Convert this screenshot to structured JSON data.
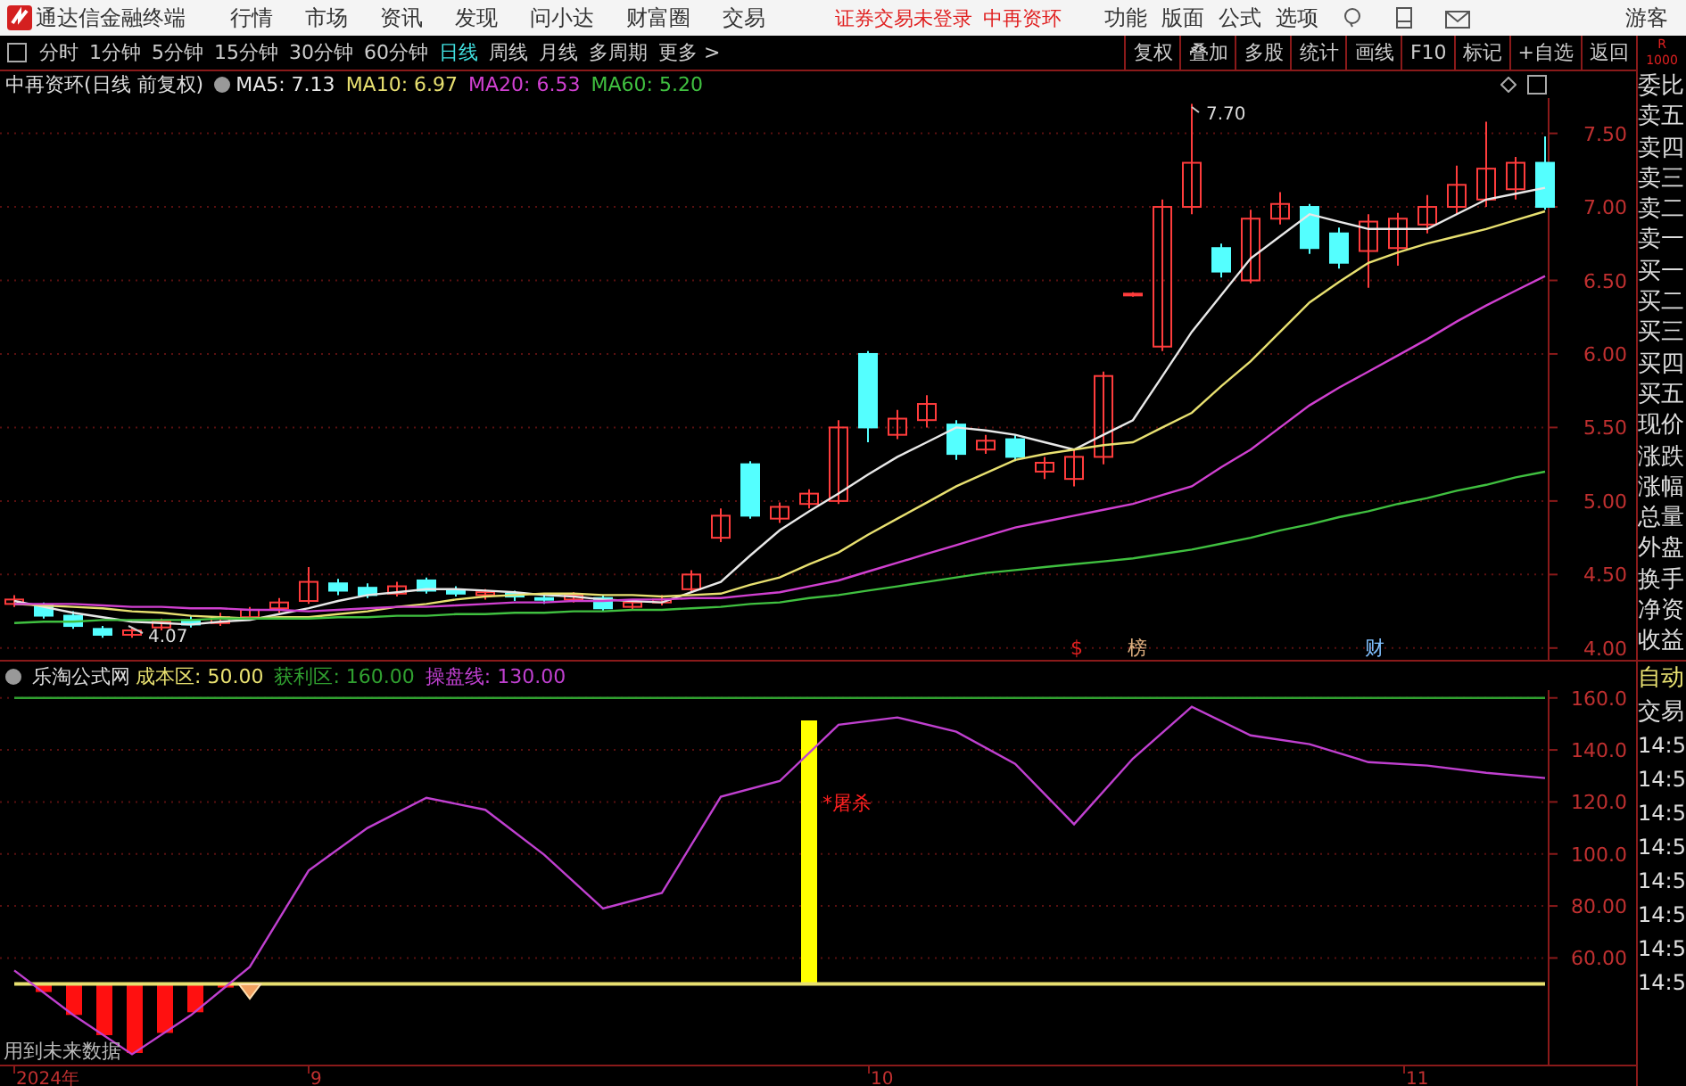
{
  "app_bar": {
    "title": "通达信金融终端",
    "menu": [
      "行情",
      "市场",
      "资讯",
      "发现",
      "问小达",
      "财富圈",
      "交易"
    ],
    "notice": "证券交易未登录",
    "stock": "中再资环",
    "tools": [
      "功能",
      "版面",
      "公式",
      "选项"
    ],
    "user": "游客"
  },
  "period_tabs": [
    {
      "label": "分时",
      "selected": false
    },
    {
      "label": "1分钟",
      "selected": false
    },
    {
      "label": "5分钟",
      "selected": false
    },
    {
      "label": "15分钟",
      "selected": false
    },
    {
      "label": "30分钟",
      "selected": false
    },
    {
      "label": "60分钟",
      "selected": false
    },
    {
      "label": "日线",
      "selected": true
    },
    {
      "label": "周线",
      "selected": false
    },
    {
      "label": "月线",
      "selected": false
    },
    {
      "label": "多周期",
      "selected": false
    },
    {
      "label": "更多 >",
      "selected": false
    }
  ],
  "actions": [
    "复权",
    "叠加",
    "多股",
    "统计",
    "画线",
    "F10",
    "标记",
    "+自选",
    "返回"
  ],
  "corner": [
    "R",
    "1000"
  ],
  "price_pane": {
    "title": "中再资环(日线 前复权)",
    "indicators": [
      {
        "label": "MA5: 7.13",
        "color": "#e8e8e8"
      },
      {
        "label": "MA10: 6.97",
        "color": "#e8e070"
      },
      {
        "label": "MA20: 6.53",
        "color": "#d040d0"
      },
      {
        "label": "MA60: 5.20",
        "color": "#40c040"
      }
    ],
    "high_label": "7.70",
    "low_label": "4.07",
    "chart_data": {
      "type": "candlestick",
      "grid": true,
      "ylim": [
        3.92,
        7.74
      ],
      "yticks": [
        {
          "value": 7.5,
          "label": "7.50"
        },
        {
          "value": 7.0,
          "label": "7.00"
        },
        {
          "value": 6.5,
          "label": "6.50"
        },
        {
          "value": 6.0,
          "label": "6.00"
        },
        {
          "value": 5.5,
          "label": "5.50"
        },
        {
          "value": 5.0,
          "label": "5.00"
        },
        {
          "value": 4.5,
          "label": "4.50"
        },
        {
          "value": 4.0,
          "label": "4.00"
        }
      ],
      "ohlc": [
        [
          4.3,
          4.36,
          4.28,
          4.33
        ],
        [
          4.29,
          4.31,
          4.2,
          4.22
        ],
        [
          4.22,
          4.25,
          4.13,
          4.15
        ],
        [
          4.13,
          4.15,
          4.07,
          4.09
        ],
        [
          4.09,
          4.14,
          4.07,
          4.12
        ],
        [
          4.14,
          4.2,
          4.12,
          4.18
        ],
        [
          4.19,
          4.22,
          4.14,
          4.16
        ],
        [
          4.17,
          4.24,
          4.15,
          4.21
        ],
        [
          4.21,
          4.28,
          4.19,
          4.26
        ],
        [
          4.27,
          4.34,
          4.24,
          4.31
        ],
        [
          4.32,
          4.55,
          4.3,
          4.45
        ],
        [
          4.44,
          4.47,
          4.36,
          4.39
        ],
        [
          4.41,
          4.44,
          4.34,
          4.36
        ],
        [
          4.37,
          4.45,
          4.35,
          4.42
        ],
        [
          4.46,
          4.48,
          4.37,
          4.39
        ],
        [
          4.39,
          4.42,
          4.35,
          4.37
        ],
        [
          4.36,
          4.4,
          4.33,
          4.38
        ],
        [
          4.37,
          4.39,
          4.32,
          4.35
        ],
        [
          4.34,
          4.37,
          4.3,
          4.33
        ],
        [
          4.33,
          4.38,
          4.31,
          4.36
        ],
        [
          4.34,
          4.36,
          4.25,
          4.27
        ],
        [
          4.28,
          4.33,
          4.26,
          4.31
        ],
        [
          4.31,
          4.36,
          4.29,
          4.33
        ],
        [
          4.4,
          4.53,
          4.38,
          4.5
        ],
        [
          4.75,
          4.95,
          4.72,
          4.9
        ],
        [
          5.25,
          5.27,
          4.88,
          4.9
        ],
        [
          4.88,
          4.99,
          4.85,
          4.96
        ],
        [
          4.98,
          5.08,
          4.95,
          5.05
        ],
        [
          5.0,
          5.55,
          4.98,
          5.5
        ],
        [
          6.0,
          6.02,
          5.4,
          5.5
        ],
        [
          5.45,
          5.62,
          5.42,
          5.56
        ],
        [
          5.55,
          5.72,
          5.5,
          5.66
        ],
        [
          5.52,
          5.55,
          5.28,
          5.32
        ],
        [
          5.35,
          5.45,
          5.32,
          5.41
        ],
        [
          5.42,
          5.45,
          5.27,
          5.3
        ],
        [
          5.2,
          5.3,
          5.15,
          5.26
        ],
        [
          5.15,
          5.35,
          5.1,
          5.3
        ],
        [
          5.3,
          5.88,
          5.25,
          5.85
        ],
        [
          6.4,
          6.42,
          6.39,
          6.41
        ],
        [
          6.05,
          7.05,
          6.02,
          7.0
        ],
        [
          7.0,
          7.7,
          6.95,
          7.3
        ],
        [
          6.72,
          6.75,
          6.52,
          6.56
        ],
        [
          6.5,
          6.98,
          6.48,
          6.92
        ],
        [
          6.92,
          7.1,
          6.88,
          7.02
        ],
        [
          7.0,
          7.02,
          6.68,
          6.72
        ],
        [
          6.82,
          6.86,
          6.58,
          6.62
        ],
        [
          6.7,
          6.95,
          6.45,
          6.9
        ],
        [
          6.72,
          6.96,
          6.6,
          6.92
        ],
        [
          6.88,
          7.08,
          6.82,
          7.0
        ],
        [
          7.0,
          7.28,
          6.95,
          7.15
        ],
        [
          7.05,
          7.58,
          7.0,
          7.26
        ],
        [
          7.12,
          7.34,
          7.05,
          7.3
        ],
        [
          7.3,
          7.48,
          6.98,
          7.0
        ]
      ],
      "series": [
        {
          "type": "line",
          "color": "#e8e8e8",
          "values": [
            4.32,
            4.28,
            4.24,
            4.21,
            4.18,
            4.17,
            4.16,
            4.18,
            4.19,
            4.23,
            4.27,
            4.32,
            4.36,
            4.38,
            4.4,
            4.4,
            4.39,
            4.38,
            4.36,
            4.35,
            4.33,
            4.32,
            4.31,
            4.38,
            4.45,
            4.63,
            4.8,
            4.93,
            5.05,
            5.18,
            5.3,
            5.4,
            5.5,
            5.48,
            5.45,
            5.4,
            5.35,
            5.45,
            5.55,
            5.85,
            6.15,
            6.4,
            6.65,
            6.8,
            6.95,
            6.9,
            6.85,
            6.85,
            6.85,
            6.95,
            7.05,
            7.09,
            7.13
          ]
        },
        {
          "type": "line",
          "color": "#e8e070",
          "values": [
            4.3,
            4.29,
            4.28,
            4.27,
            4.25,
            4.24,
            4.22,
            4.21,
            4.2,
            4.21,
            4.21,
            4.23,
            4.25,
            4.28,
            4.3,
            4.33,
            4.35,
            4.36,
            4.37,
            4.37,
            4.36,
            4.36,
            4.35,
            4.36,
            4.37,
            4.43,
            4.48,
            4.57,
            4.65,
            4.77,
            4.88,
            4.99,
            5.1,
            5.19,
            5.28,
            5.32,
            5.35,
            5.38,
            5.4,
            5.5,
            5.6,
            5.78,
            5.95,
            6.15,
            6.35,
            6.49,
            6.62,
            6.69,
            6.75,
            6.8,
            6.85,
            6.91,
            6.97
          ]
        },
        {
          "type": "line",
          "color": "#d040d0",
          "values": [
            4.3,
            4.3,
            4.3,
            4.29,
            4.28,
            4.28,
            4.27,
            4.27,
            4.26,
            4.26,
            4.25,
            4.26,
            4.27,
            4.28,
            4.28,
            4.29,
            4.3,
            4.31,
            4.31,
            4.32,
            4.32,
            4.33,
            4.33,
            4.34,
            4.34,
            4.36,
            4.38,
            4.42,
            4.46,
            4.52,
            4.58,
            4.64,
            4.7,
            4.76,
            4.82,
            4.86,
            4.9,
            4.94,
            4.98,
            5.04,
            5.1,
            5.23,
            5.35,
            5.5,
            5.65,
            5.77,
            5.88,
            5.99,
            6.1,
            6.22,
            6.33,
            6.43,
            6.53
          ]
        },
        {
          "type": "line",
          "color": "#40c040",
          "values": [
            4.17,
            4.18,
            4.18,
            4.19,
            4.19,
            4.19,
            4.19,
            4.2,
            4.2,
            4.2,
            4.2,
            4.21,
            4.21,
            4.22,
            4.22,
            4.23,
            4.23,
            4.24,
            4.24,
            4.25,
            4.25,
            4.26,
            4.26,
            4.27,
            4.28,
            4.3,
            4.31,
            4.34,
            4.36,
            4.39,
            4.42,
            4.45,
            4.48,
            4.51,
            4.53,
            4.55,
            4.57,
            4.59,
            4.61,
            4.64,
            4.67,
            4.71,
            4.75,
            4.8,
            4.84,
            4.89,
            4.93,
            4.98,
            5.02,
            5.07,
            5.11,
            5.16,
            5.2
          ]
        }
      ]
    },
    "markers": [
      {
        "text": "$",
        "color": "#e02020"
      },
      {
        "text": "榜",
        "color": "#e0b080"
      },
      {
        "text": "财",
        "color": "#80c0ff"
      }
    ]
  },
  "indicator_pane": {
    "title": "乐淘公式网",
    "indicators": [
      {
        "label": "成本区: 50.00",
        "color": "#e8e070"
      },
      {
        "label": "获利区: 160.00",
        "color": "#30a030"
      },
      {
        "label": "操盘线: 130.00",
        "color": "#c040d0"
      }
    ],
    "signal_label": "*屠杀",
    "warning": "用到未来数据",
    "date_labels": [
      "2024年",
      "9",
      "10",
      "11"
    ],
    "chart_data": {
      "type": "line",
      "grid": true,
      "ylim": [
        19,
        163
      ],
      "yticks": [
        {
          "value": 160,
          "label": "160.0"
        },
        {
          "value": 140,
          "label": "140.0"
        },
        {
          "value": 120,
          "label": "120.0"
        },
        {
          "value": 100,
          "label": "100.0"
        },
        {
          "value": 80,
          "label": "80.00"
        },
        {
          "value": 60,
          "label": "60.00"
        }
      ],
      "series": [
        {
          "color": "#e8e070",
          "values": [
            50,
            50,
            50,
            50,
            50,
            50,
            50,
            50,
            50,
            50,
            50,
            50,
            50,
            50,
            50,
            50,
            50,
            50,
            50,
            50,
            50,
            50,
            50,
            50,
            50,
            50,
            50
          ]
        },
        {
          "color": "#30a030",
          "values": [
            160,
            160,
            160,
            160,
            160,
            160,
            160,
            160,
            160,
            160,
            160,
            160,
            160,
            160,
            160,
            160,
            160,
            160,
            160,
            160,
            160,
            160,
            160,
            160,
            160,
            160,
            160
          ]
        },
        {
          "color": "#c040d0",
          "values": [
            55.2,
            38.1,
            23,
            38,
            56.6,
            93.6,
            110,
            121.6,
            117,
            99.7,
            79,
            85,
            122,
            128,
            149.7,
            152.5,
            147,
            134.7,
            111.4,
            136.7,
            156.6,
            145.6,
            142.2,
            135.3,
            134,
            131.2,
            129.2
          ]
        }
      ]
    }
  },
  "quote_labels": [
    "委比",
    "卖五",
    "卖四",
    "卖三",
    "卖二",
    "卖一",
    "买一",
    "买二",
    "买三",
    "买四",
    "买五",
    "现价",
    "涨跌",
    "涨幅",
    "总量",
    "外盘",
    "换手",
    "净资",
    "收益"
  ],
  "trade_labels": [
    "自动",
    "交易"
  ],
  "times": [
    "14:5",
    "14:5",
    "14:5",
    "14:5",
    "14:5",
    "14:5",
    "14:5",
    "14:5"
  ]
}
